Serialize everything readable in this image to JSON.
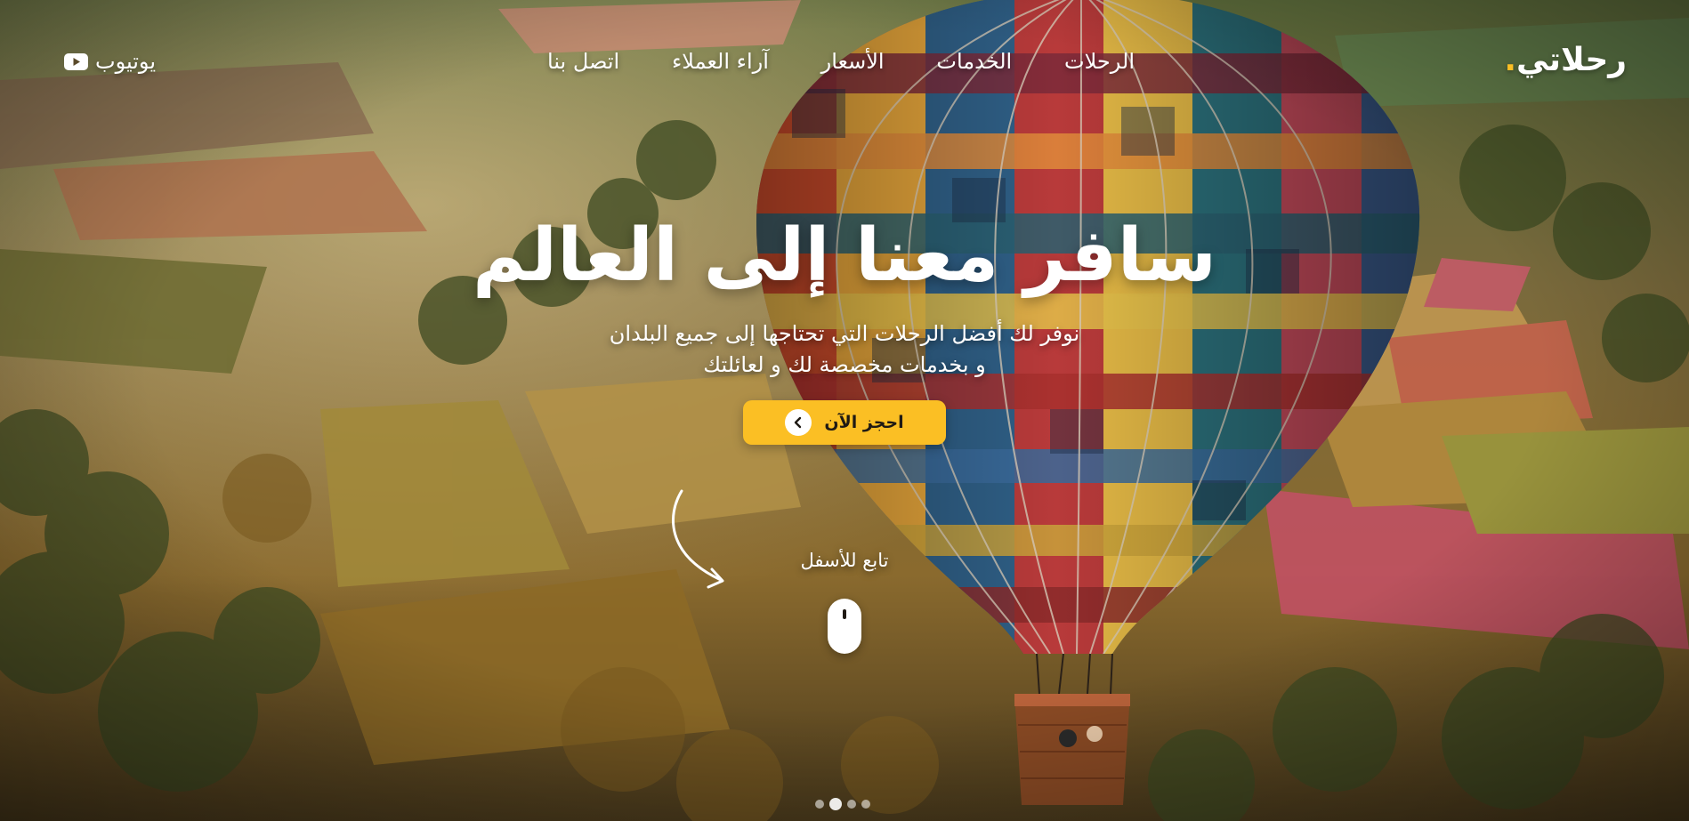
{
  "header": {
    "brand": "رحلاتي",
    "brand_dot": ".",
    "nav": [
      {
        "label": "الرحلات"
      },
      {
        "label": "الخدمات"
      },
      {
        "label": "الأسعار"
      },
      {
        "label": "آراء العملاء"
      },
      {
        "label": "اتصل بنا"
      }
    ],
    "youtube_label": "يوتيوب"
  },
  "hero": {
    "title": "سافر معنا إلى العالم",
    "subtitle_line1": "نوفر لك أفضل الرحلات التي تحتاجها إلى جميع البلدان",
    "subtitle_line2": "و بخدمات مخصصة لك و لعائلتك",
    "cta_label": "احجز الآن"
  },
  "scroll_hint": {
    "label": "تابع للأسفل"
  },
  "slider": {
    "dot_count": 4,
    "active_index": 1
  },
  "colors": {
    "accent": "#fbbf24",
    "text": "#ffffff",
    "button_text": "#1f1a14"
  },
  "icons": {
    "youtube": "youtube-icon",
    "cta_arrow": "chevron-left-icon",
    "scroll_arrow": "curved-arrow-icon",
    "mouse": "mouse-icon"
  }
}
